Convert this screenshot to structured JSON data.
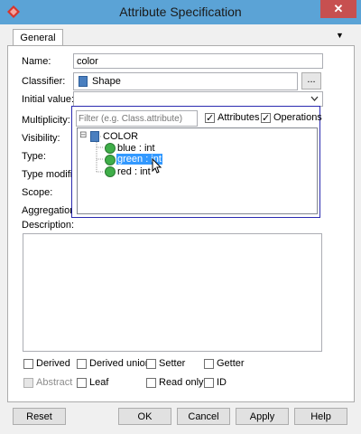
{
  "window": {
    "title": "Attribute Specification",
    "close": "✕"
  },
  "tabs": {
    "general": "General",
    "menu_arrow": "▼"
  },
  "form": {
    "name_label": "Name:",
    "name_value": "color",
    "classifier_label": "Classifier:",
    "classifier_value": "Shape",
    "classifier_button": "...",
    "initial_value_label": "Initial value:",
    "initial_value": "",
    "multiplicity_label": "Multiplicity:",
    "visibility_label": "Visibility:",
    "type_label": "Type:",
    "type_modifier_label": "Type modifier:",
    "scope_label": "Scope:",
    "aggregation_label": "Aggregation:",
    "description_label": "Description:"
  },
  "popup": {
    "filter_placeholder": "Filter (e.g. Class.attribute)",
    "attributes_label": "Attributes",
    "attributes_checked": true,
    "operations_label": "Operations",
    "operations_checked": true,
    "tree": {
      "expander": "⊟",
      "root": "COLOR",
      "items": [
        "blue : int",
        "green : int",
        "red : int"
      ],
      "selected": "green : int"
    }
  },
  "checkboxes": {
    "derived": "Derived",
    "derived_union": "Derived union",
    "setter": "Setter",
    "getter": "Getter",
    "abstract": "Abstract",
    "leaf": "Leaf",
    "read_only": "Read only",
    "id": "ID"
  },
  "buttons": {
    "reset": "Reset",
    "ok": "OK",
    "cancel": "Cancel",
    "apply": "Apply",
    "help": "Help"
  },
  "colors": {
    "titlebar": "#5ba3d6",
    "close": "#c75050",
    "selection": "#3399ff",
    "popup_border": "#2b2bb0"
  }
}
